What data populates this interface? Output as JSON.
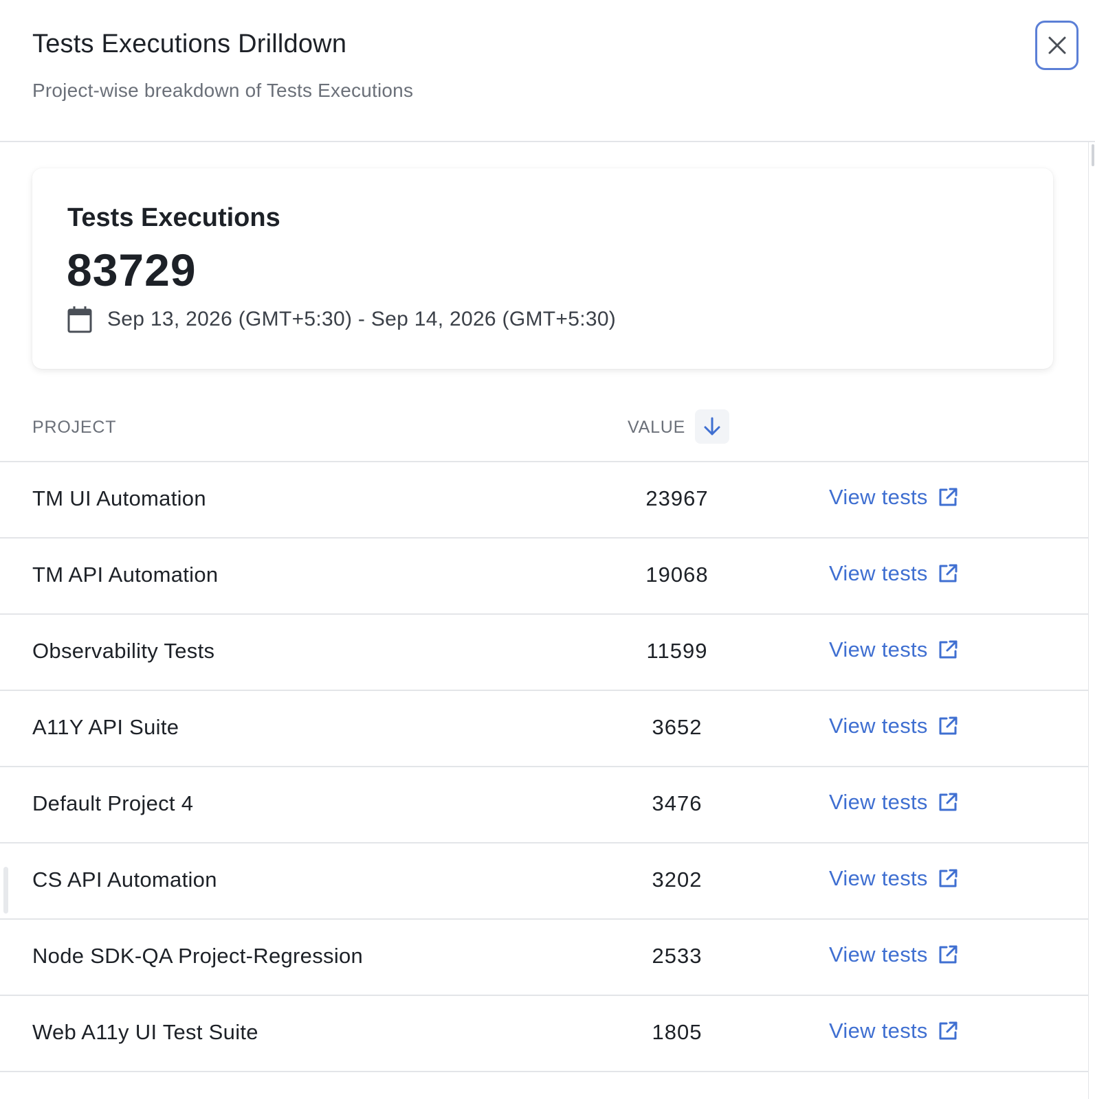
{
  "header": {
    "title": "Tests Executions Drilldown",
    "subtitle": "Project-wise breakdown of Tests Executions",
    "close_icon": "close-icon"
  },
  "summary": {
    "label": "Tests Executions",
    "value": "83729",
    "date_range": "Sep 13, 2026 (GMT+5:30) - Sep 14, 2026 (GMT+5:30)",
    "date_icon": "calendar-icon"
  },
  "table": {
    "columns": {
      "project": "PROJECT",
      "value": "VALUE"
    },
    "sort": {
      "column": "value",
      "direction": "descending",
      "icon": "arrow-down-icon"
    },
    "link_icon": "external-link-icon",
    "rows": [
      {
        "project": "TM UI Automation",
        "value": "23967",
        "link": "View tests"
      },
      {
        "project": "TM API Automation",
        "value": "19068",
        "link": "View tests"
      },
      {
        "project": "Observability Tests",
        "value": "11599",
        "link": "View tests"
      },
      {
        "project": "A11Y API Suite",
        "value": "3652",
        "link": "View tests"
      },
      {
        "project": "Default Project 4",
        "value": "3476",
        "link": "View tests"
      },
      {
        "project": "CS API Automation",
        "value": "3202",
        "link": "View tests"
      },
      {
        "project": "Node SDK-QA Project-Regression",
        "value": "2533",
        "link": "View tests"
      },
      {
        "project": "Web A11y UI Test Suite",
        "value": "1805",
        "link": "View tests"
      }
    ]
  },
  "colors": {
    "accent": "#3f6fd1",
    "close_border": "#5b7fd6",
    "text_primary": "#1d2127",
    "text_muted": "#6b7079",
    "divider": "#e3e5e8"
  }
}
